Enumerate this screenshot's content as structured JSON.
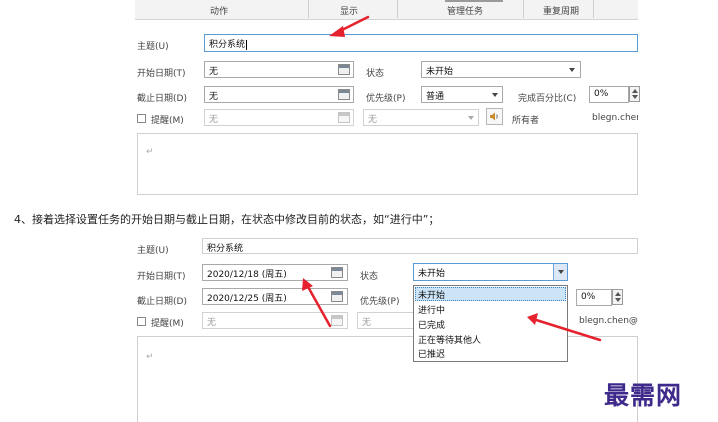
{
  "ribbon": {
    "tabs": [
      "动作",
      "显示",
      "管理任务",
      "重复周期"
    ]
  },
  "top_form": {
    "subject_label": "主题(U)",
    "subject_value": "积分系统",
    "start_label": "开始日期(T)",
    "start_value": "无",
    "status_label": "状态",
    "status_value": "未开始",
    "due_label": "截止日期(D)",
    "due_value": "无",
    "priority_label": "优先级(P)",
    "priority_value": "普通",
    "percent_label": "完成百分比(C)",
    "percent_value": "0%",
    "reminder_label": "提醒(M)",
    "reminder_value": "无",
    "reminder_time_value": "无",
    "owner_label": "所有者",
    "owner_value": "blegn.chen"
  },
  "caption": "4、接着选择设置任务的开始日期与截止日期，在状态中修改目前的状态，如“进行中”；",
  "bottom_form": {
    "subject_label": "主题(U)",
    "subject_value": "积分系统",
    "start_label": "开始日期(T)",
    "start_value": "2020/12/18 (周五)",
    "status_label": "状态",
    "status_value": "未开始",
    "due_label": "截止日期(D)",
    "due_value": "2020/12/25 (周五)",
    "priority_label": "优先级(P)",
    "percent_value": "0%",
    "reminder_label": "提醒(M)",
    "reminder_value": "无",
    "reminder_time_value": "无",
    "owner_value": "blegn.chen@"
  },
  "status_options": [
    "未开始",
    "进行中",
    "已完成",
    "正在等待其他人",
    "已推迟"
  ],
  "highlighted_option": "未开始",
  "paragraph_mark": "↵",
  "watermark": "最需网",
  "colors": {
    "arrow": "#e5222e",
    "watermark": "#3f2a8c",
    "highlight": "#cce4f7"
  }
}
